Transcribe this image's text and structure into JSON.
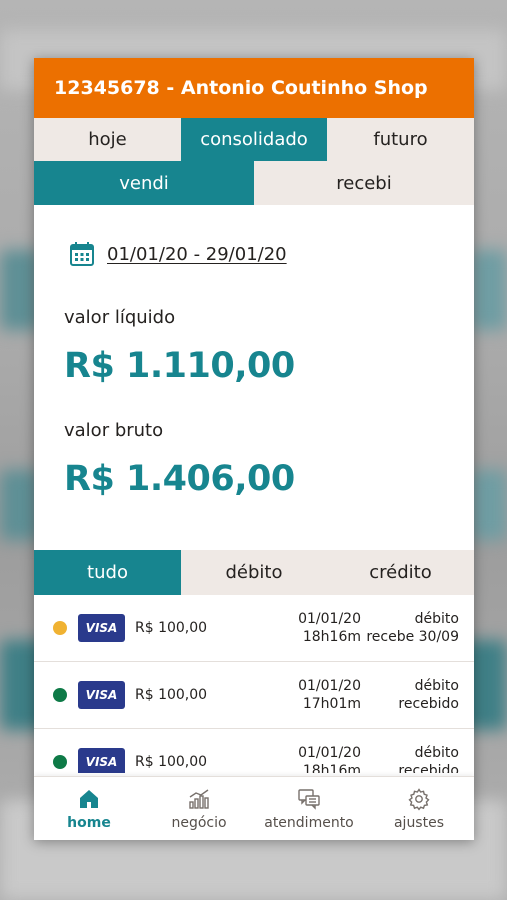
{
  "header": {
    "title": "12345678 - Antonio Coutinho Shop"
  },
  "period_tabs": [
    {
      "label": "hoje",
      "active": false
    },
    {
      "label": "consolidado",
      "active": true
    },
    {
      "label": "futuro",
      "active": false
    }
  ],
  "type_tabs": [
    {
      "label": "vendi",
      "active": true
    },
    {
      "label": "recebi",
      "active": false
    }
  ],
  "summary": {
    "date_range": "01/01/20 - 29/01/20",
    "net_label": "valor líquido",
    "net_value": "R$ 1.110,00",
    "gross_label": "valor bruto",
    "gross_value": "R$ 1.406,00"
  },
  "filter_tabs": [
    {
      "label": "tudo",
      "active": true
    },
    {
      "label": "débito",
      "active": false
    },
    {
      "label": "crédito",
      "active": false
    }
  ],
  "transactions": [
    {
      "status_color": "#f0b232",
      "brand": "VISA",
      "value": "R$ 100,00",
      "date": "01/01/20",
      "time": "18h16m",
      "type": "débito",
      "status": "recebe 30/09"
    },
    {
      "status_color": "#0e7a47",
      "brand": "VISA",
      "value": "R$ 100,00",
      "date": "01/01/20",
      "time": "17h01m",
      "type": "débito",
      "status": "recebido"
    },
    {
      "status_color": "#0e7a47",
      "brand": "VISA",
      "value": "R$ 100,00",
      "date": "01/01/20",
      "time": "18h16m",
      "type": "débito",
      "status": "recebido"
    }
  ],
  "bottom_nav": [
    {
      "label": "home",
      "icon": "home-icon",
      "active": true
    },
    {
      "label": "negócio",
      "icon": "chart-icon",
      "active": false
    },
    {
      "label": "atendimento",
      "icon": "chat-icon",
      "active": false
    },
    {
      "label": "ajustes",
      "icon": "gear-icon",
      "active": false
    }
  ],
  "colors": {
    "brand_orange": "#ec7000",
    "accent_teal": "#17858f",
    "tab_bg": "#efe9e5"
  }
}
